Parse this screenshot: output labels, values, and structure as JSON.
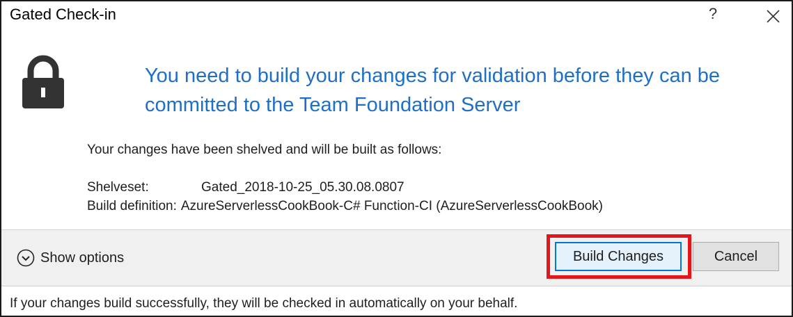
{
  "window": {
    "title": "Gated Check-in",
    "help_glyph": "?"
  },
  "message": {
    "headline": "You need to build your changes for validation before they can be committed to the Team Foundation Server",
    "intro": "Your changes have been shelved and will be built as follows:",
    "details": [
      {
        "label": "Shelveset:",
        "value": "Gated_2018-10-25_05.30.08.0807"
      },
      {
        "label": "Build definition:",
        "value": "AzureServerlessCookBook-C# Function-CI (AzureServerlessCookBook)"
      }
    ]
  },
  "footer": {
    "show_options_label": "Show options",
    "build_button_label": "Build Changes",
    "cancel_button_label": "Cancel",
    "highlight_color": "#e3161c"
  },
  "status": {
    "text": "If your changes build successfully, they will be checked in automatically on your behalf."
  },
  "icons": {
    "lock": "lock-icon",
    "close": "close-icon",
    "expand": "chevron-down-circle-icon"
  },
  "colors": {
    "headline": "#1e6fc5",
    "footer_bg": "#f0f0f0",
    "primary_border": "#0078d7"
  }
}
